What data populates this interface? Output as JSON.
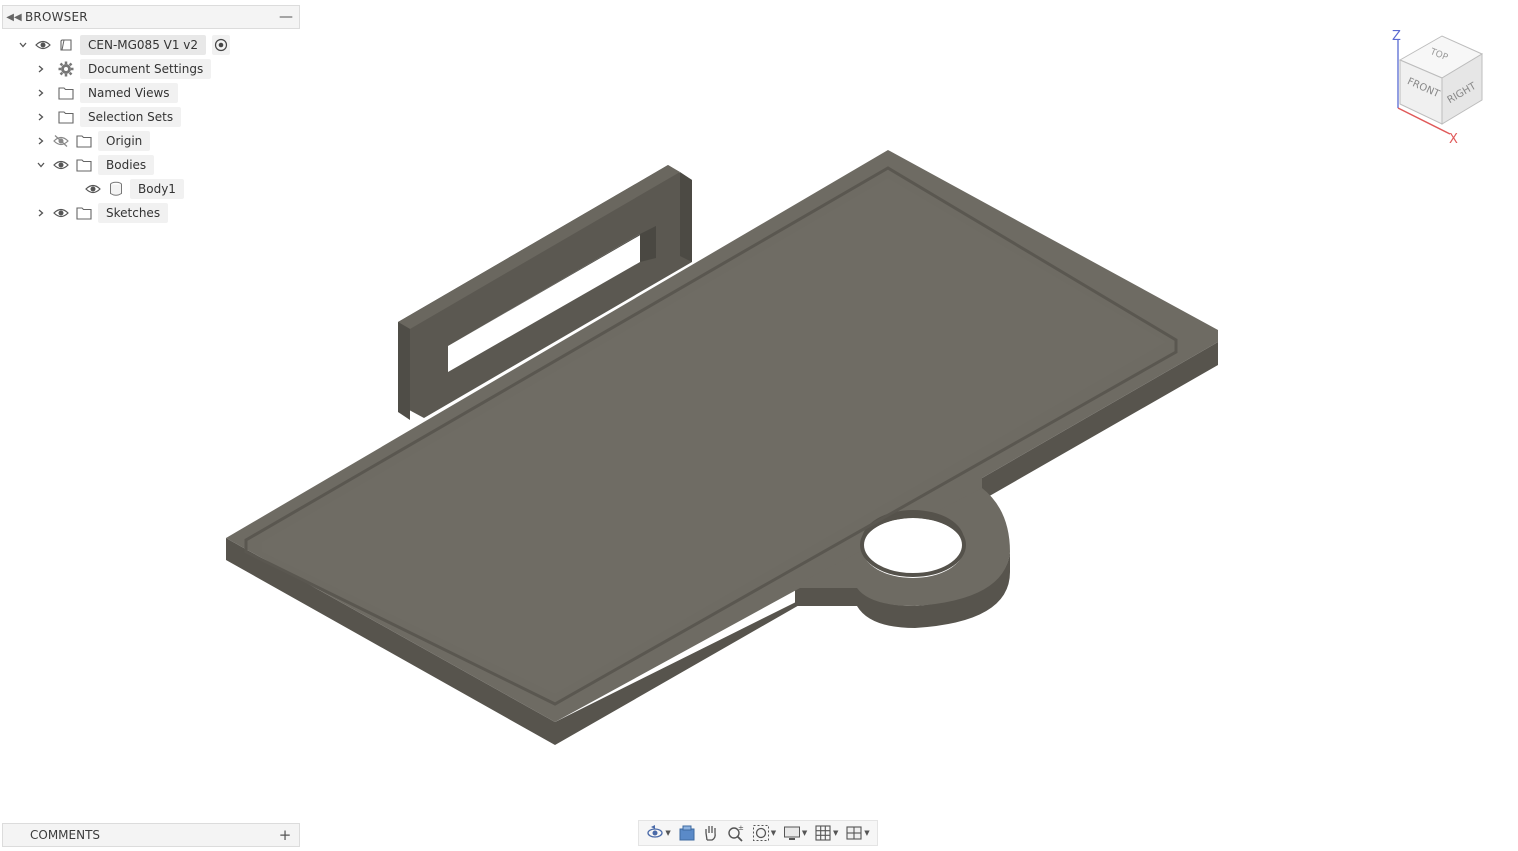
{
  "browser": {
    "title": "BROWSER",
    "root": {
      "label": "CEN-MG085 V1 v2"
    },
    "items": [
      {
        "label": "Document Settings"
      },
      {
        "label": "Named Views"
      },
      {
        "label": "Selection Sets"
      },
      {
        "label": "Origin"
      },
      {
        "label": "Bodies"
      },
      {
        "label": "Body1"
      },
      {
        "label": "Sketches"
      }
    ]
  },
  "comments": {
    "title": "COMMENTS"
  },
  "viewcube": {
    "top": "TOP",
    "front": "FRONT",
    "right": "RIGHT",
    "axis_z": "Z",
    "axis_x": "X"
  },
  "colors": {
    "model_face": "#6e6b63",
    "model_edge": "#55524b",
    "model_dark": "#4a4842",
    "panel_bg": "#f4f4f4"
  },
  "toolbar": {
    "icons": [
      "orbit-icon",
      "look-at-icon",
      "pan-icon",
      "zoom-icon",
      "fit-icon",
      "display-settings-icon",
      "grid-icon",
      "viewports-icon"
    ]
  }
}
